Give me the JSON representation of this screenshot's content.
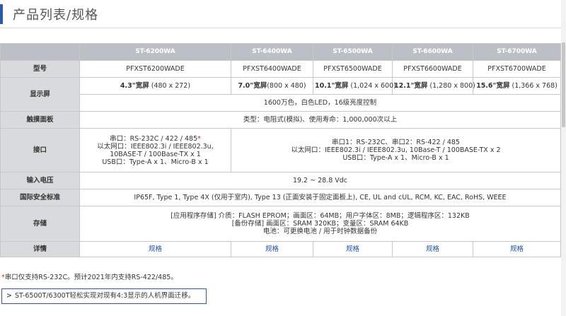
{
  "header": {
    "title": "产品列表/规格"
  },
  "table": {
    "models": [
      "ST-6200WA",
      "ST-6400WA",
      "ST-6500WA",
      "ST-6600WA",
      "ST-6700WA"
    ],
    "labels": {
      "model_no": "型号",
      "display": "显示屏",
      "touch": "触摸面板",
      "interface": "接口",
      "voltage": "输入电压",
      "standards": "国际安全标准",
      "storage": "存储",
      "details": "详情"
    },
    "part_numbers": [
      "PFXST6200WADE",
      "PFXST6400WADE",
      "PFXST6500WADE",
      "PFXST6600WADE",
      "PFXST6700WADE"
    ],
    "display_size": [
      {
        "size": "4.3\"宽屏",
        "res": " (480 x 272)"
      },
      {
        "size": "7.0\"宽屏",
        "res": "(800 x 480)"
      },
      {
        "size": "10.1\"宽屏",
        "res": " (1,024 x 600)"
      },
      {
        "size": "12.1\"宽屏",
        "res": " (1,280 x 800)"
      },
      {
        "size": "15.6\"宽屏",
        "res": " (1,366 x 768)"
      }
    ],
    "display_colors": "1600万色，白色LED，16级亮度控制",
    "touch_panel": "类型：电阻式(模拟)、使用寿命：1,000,000次以上",
    "interface_6200": {
      "line1_pre": "串口：RS-232C / 422 / 485",
      "line1_mark": "*",
      "line2": "以太网口：IEEE802.3i / IEEE802.3u,",
      "line3": "10BASE-T / 100Base-TX x 1",
      "line4": "USB口：Type-A x 1、Micro-B x 1"
    },
    "interface_others": {
      "line1": "串口1：RS-232C、串口2：RS-422 / 485",
      "line2": "以太网口：IEEE802.3i / IEEE802.3u, 10Base-T / 100BASE-TX x 2",
      "line3": "USB口：Type-A x 1、Micro-B x 1"
    },
    "voltage": "19.2 ~ 28.8 Vdc",
    "standards": "IP65F, Type 1, Type 4X (仅用于室内), Type 13 (正面安装于固定面板上), CE, UL and cUL, RCM, KC, EAC, RoHS, WEEE",
    "storage": {
      "line1": "[应用程序存储] 介质：FLASH EPROM；画面区：64MB；用户字体区：8MB；逻辑程序区：132KB",
      "line2": "[备份存储] 画面区：SRAM 320KB；变量区：SRAM 64KB",
      "line3": "电池：可更换电池 / 用于时钟数据备份"
    },
    "details_link": "规格"
  },
  "footnote": {
    "mark": "*",
    "text": "串口仅支持RS-232C。预计2021年内支持RS-422/485。"
  },
  "notice": {
    "arrow": ">",
    "text": "ST-6500T/6300T轻松实现对现有4:3显示的人机界面迁移。"
  },
  "colors": {
    "accent": "#2b5aa8",
    "header_bg": "#bcc0c6",
    "label_bg": "#d9dadd",
    "link": "#1f4ea3",
    "mark": "#dd2222"
  }
}
